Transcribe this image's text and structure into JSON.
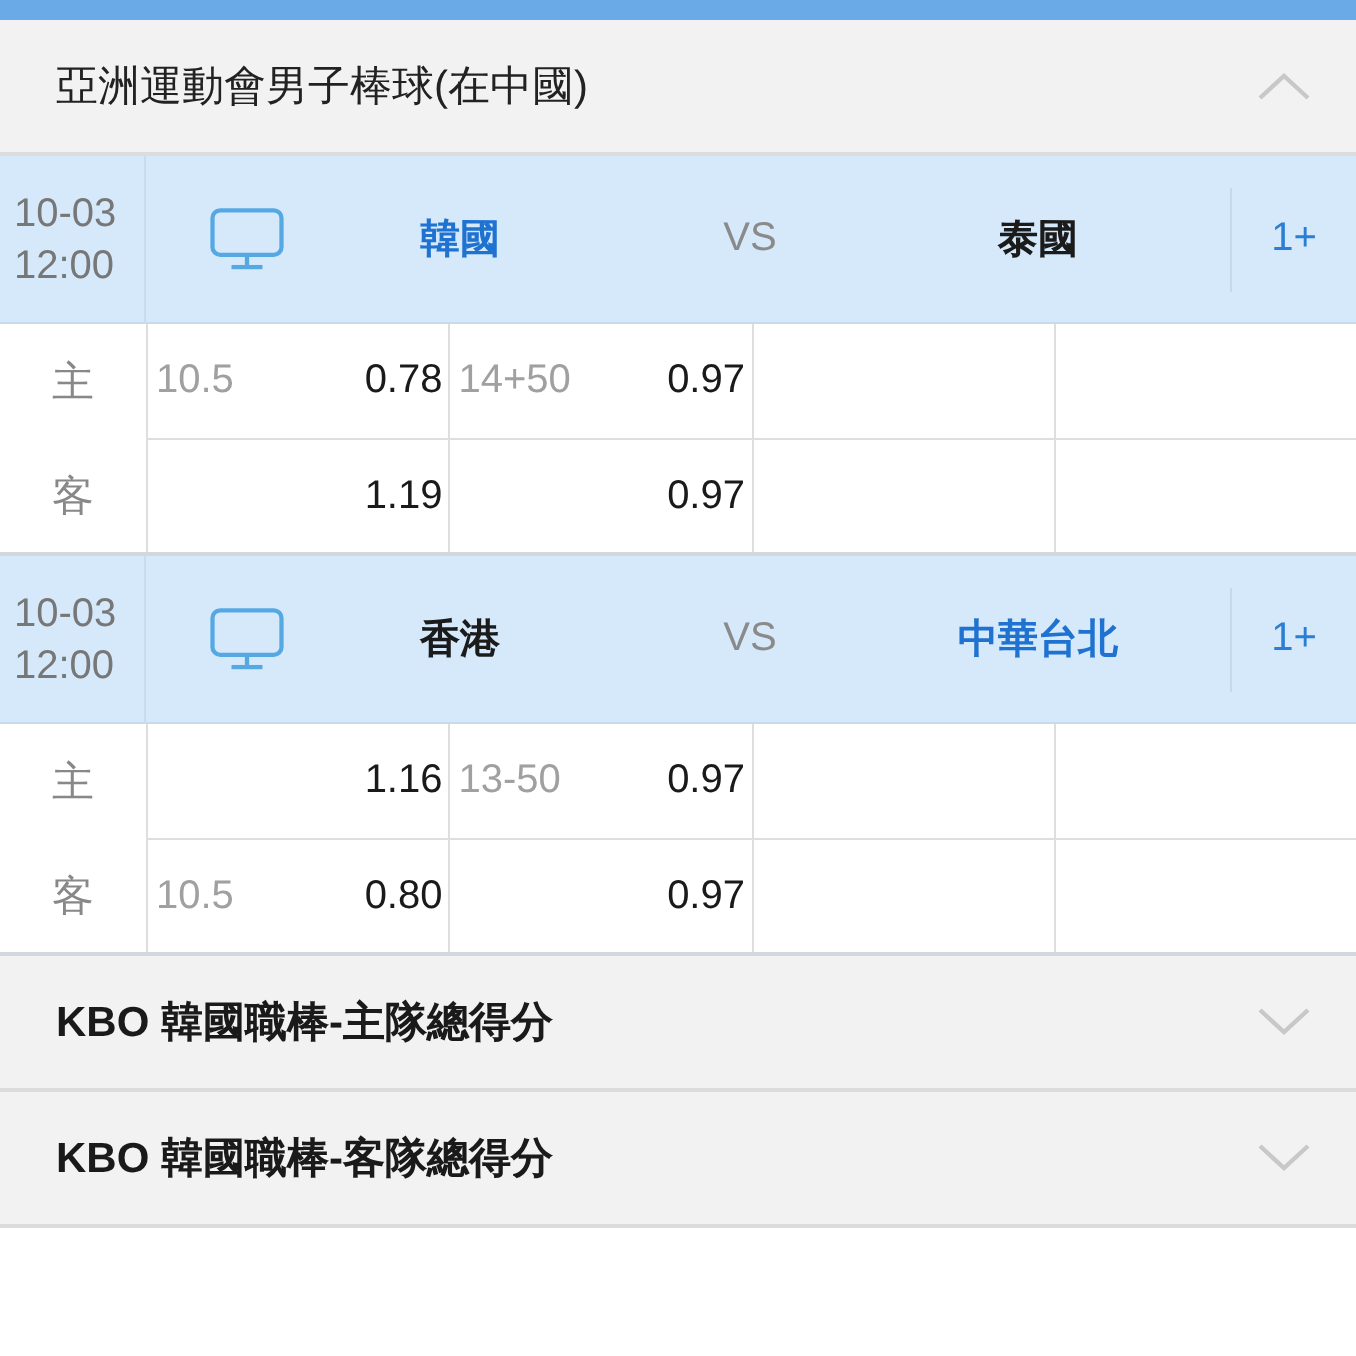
{
  "leagues": [
    {
      "title": "亞洲運動會男子棒球(在中國)",
      "expanded": true,
      "matches": [
        {
          "date": "10-03",
          "time": "12:00",
          "home": {
            "name": "韓國",
            "highlighted": true
          },
          "vs": "VS",
          "away": {
            "name": "泰國",
            "highlighted": false
          },
          "more": "1+",
          "rows": [
            {
              "side": "主",
              "cells": [
                {
                  "line": "10.5",
                  "odds": "0.78"
                },
                {
                  "line": "14+50",
                  "odds": "0.97"
                }
              ]
            },
            {
              "side": "客",
              "cells": [
                {
                  "odds": "1.19"
                },
                {
                  "odds": "0.97"
                }
              ]
            }
          ]
        },
        {
          "date": "10-03",
          "time": "12:00",
          "home": {
            "name": "香港",
            "highlighted": false
          },
          "vs": "VS",
          "away": {
            "name": "中華台北",
            "highlighted": true
          },
          "more": "1+",
          "rows": [
            {
              "side": "主",
              "cells": [
                {
                  "odds": "1.16"
                },
                {
                  "line": "13-50",
                  "odds": "0.97"
                }
              ]
            },
            {
              "side": "客",
              "cells": [
                {
                  "line": "10.5",
                  "odds": "0.80"
                },
                {
                  "odds": "0.97"
                }
              ]
            }
          ]
        }
      ]
    },
    {
      "title": "KBO 韓國職棒-主隊總得分",
      "expanded": false
    },
    {
      "title": "KBO 韓國職棒-客隊總得分",
      "expanded": false
    }
  ]
}
